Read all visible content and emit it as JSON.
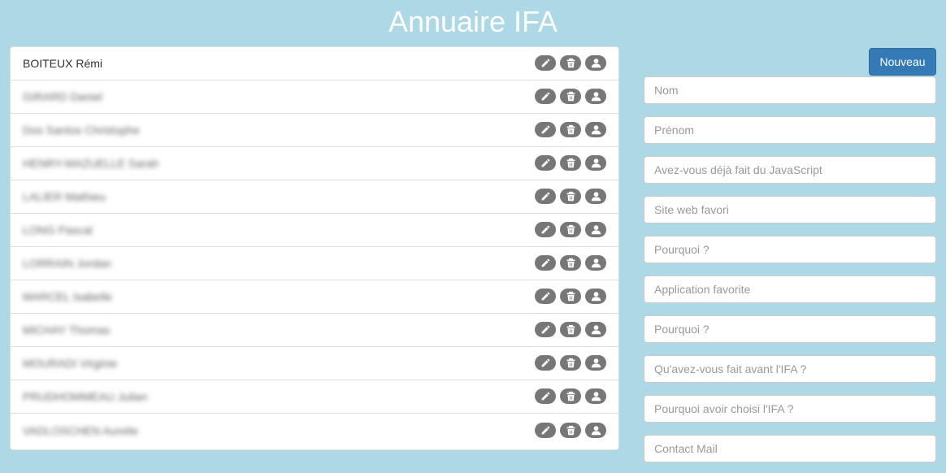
{
  "header": {
    "title": "Annuaire IFA"
  },
  "list": {
    "items": [
      {
        "name": "BOITEUX Rémi",
        "blurred": false
      },
      {
        "name": "GIRARD Daniel",
        "blurred": true
      },
      {
        "name": "Dos Santos Christophe",
        "blurred": true
      },
      {
        "name": "HENRY-MAZUELLE Sarah",
        "blurred": true
      },
      {
        "name": "LALIER Mathieu",
        "blurred": true
      },
      {
        "name": "LONG Pascal",
        "blurred": true
      },
      {
        "name": "LORRAIN Jordan",
        "blurred": true
      },
      {
        "name": "MARCEL Isabelle",
        "blurred": true
      },
      {
        "name": "MICHAY Thomas",
        "blurred": true
      },
      {
        "name": "MOURADI Virginie",
        "blurred": true
      },
      {
        "name": "PRUDHOMMEAU Julian",
        "blurred": true
      },
      {
        "name": "VADLOSCHEN Aurelie",
        "blurred": true
      }
    ],
    "action_icons": [
      "pencil-icon",
      "trash-icon",
      "user-icon"
    ]
  },
  "form": {
    "new_button_label": "Nouveau",
    "fields": [
      {
        "placeholder": "Nom"
      },
      {
        "placeholder": "Prénom"
      },
      {
        "placeholder": "Avez-vous déjà fait du JavaScript"
      },
      {
        "placeholder": "Site web favori"
      },
      {
        "placeholder": "Pourquoi ?"
      },
      {
        "placeholder": "Application favorite"
      },
      {
        "placeholder": "Pourquoi ?"
      },
      {
        "placeholder": "Qu'avez-vous fait avant l'IFA ?"
      },
      {
        "placeholder": "Pourquoi avoir choisi l'IFA ?"
      },
      {
        "placeholder": "Contact Mail"
      }
    ]
  },
  "colors": {
    "background": "#add8e6",
    "primary_button": "#337ab7",
    "action_icon_bg": "#777777"
  }
}
